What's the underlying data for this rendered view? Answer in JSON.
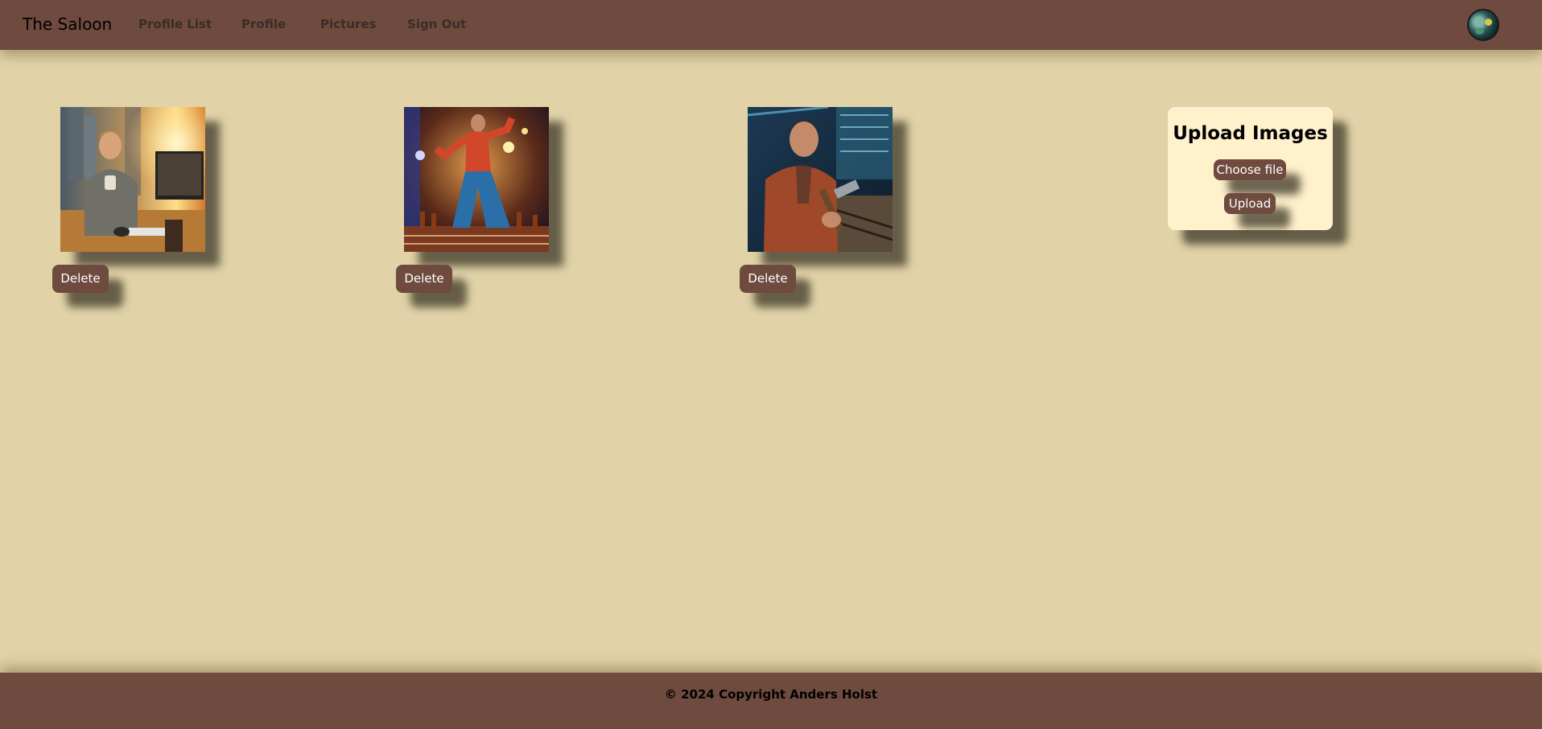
{
  "navbar": {
    "brand": "The Saloon",
    "links": [
      "Profile List",
      "Profile",
      "Pictures",
      "Sign Out"
    ],
    "avatar_icon": "user-avatar",
    "background_color": "#6f4a3e"
  },
  "gallery": {
    "delete_label": "Delete",
    "images": [
      {
        "description_icon": "man-at-desk-with-coffee-photo"
      },
      {
        "description_icon": "man-dancing-disco-photo"
      },
      {
        "description_icon": "man-holding-hammer-photo"
      }
    ]
  },
  "upload": {
    "title": "Upload Images",
    "choose_file_label": "Choose file",
    "upload_label": "Upload"
  },
  "footer": {
    "copyright": "© 2024 Copyright Anders Holst"
  },
  "colors": {
    "page_background": "#e1d3a7",
    "accent": "#6f4a3e",
    "card_background": "#fff1cb"
  }
}
